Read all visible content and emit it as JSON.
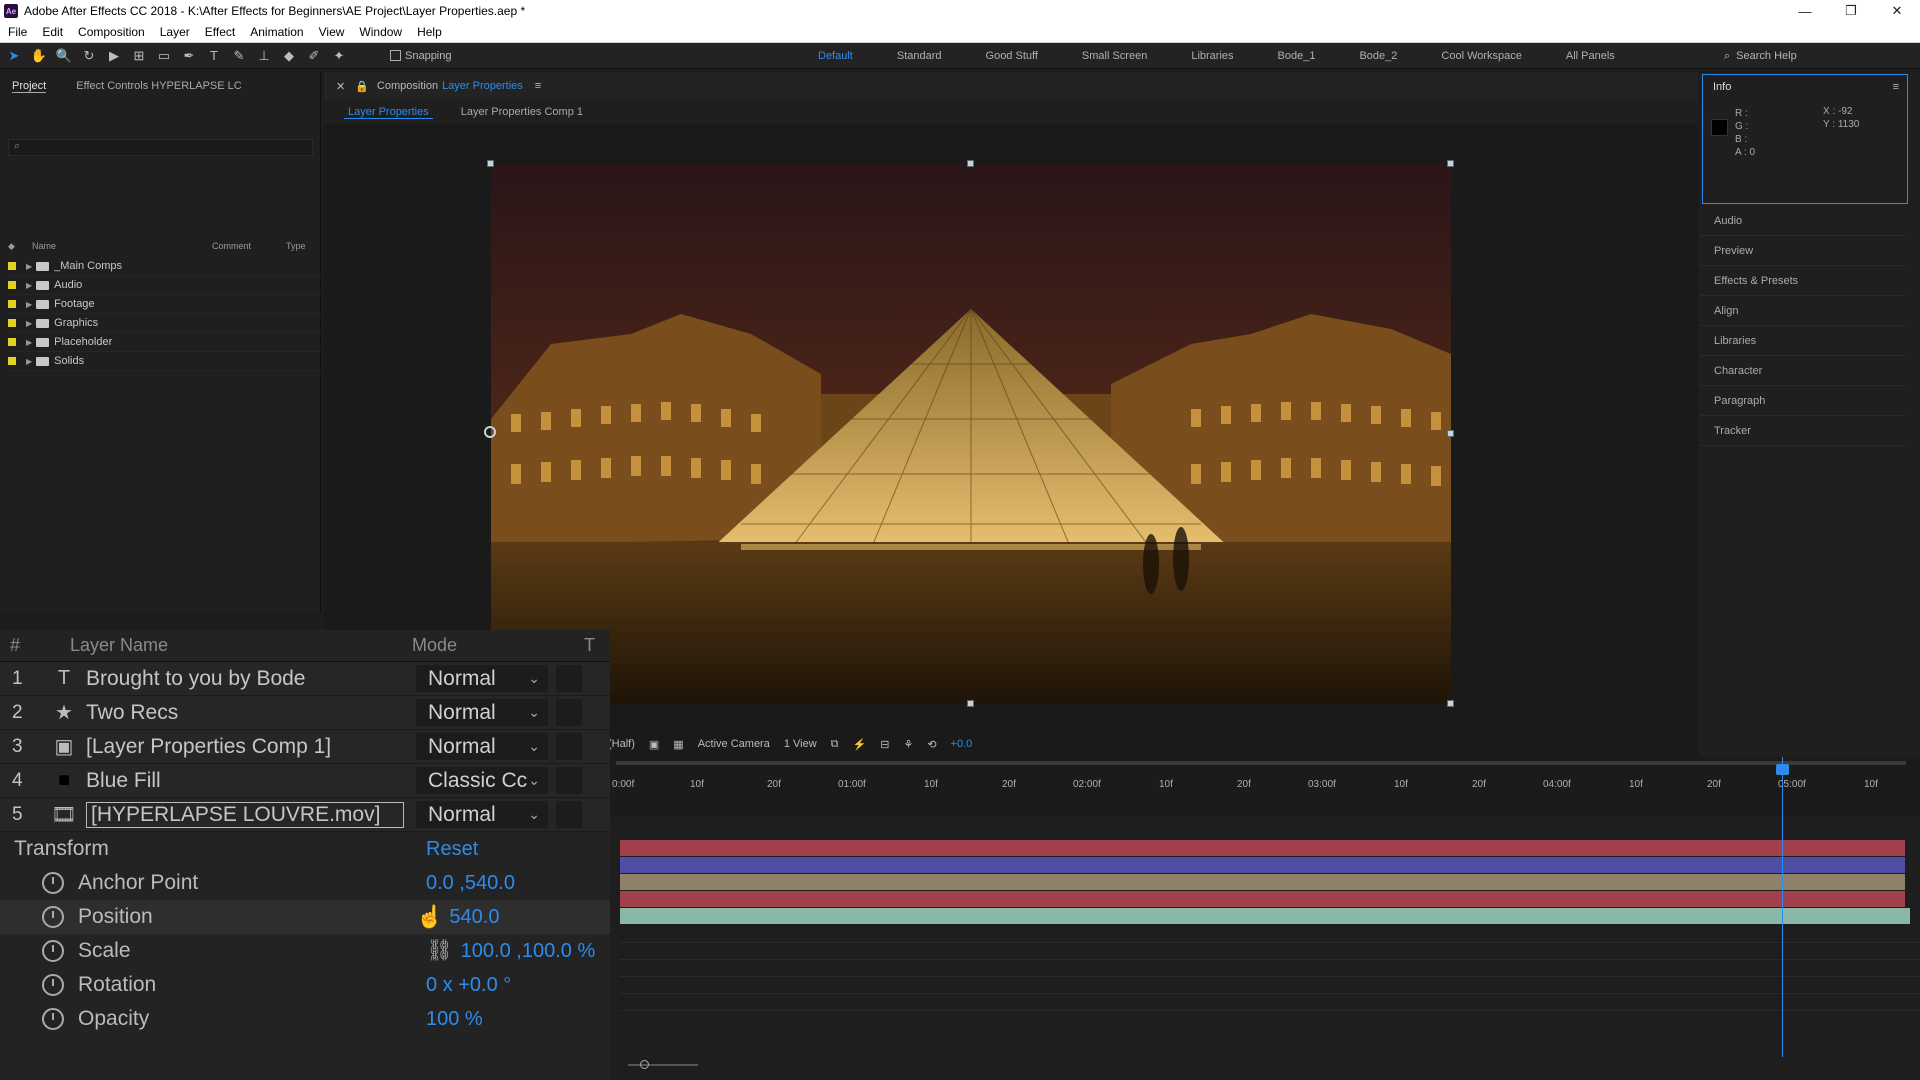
{
  "window": {
    "title": "Adobe After Effects CC 2018 - K:\\After Effects for Beginners\\AE Project\\Layer Properties.aep *",
    "logo": "Ae",
    "controls": [
      "—",
      "❐",
      "✕"
    ]
  },
  "menu": [
    "File",
    "Edit",
    "Composition",
    "Layer",
    "Effect",
    "Animation",
    "View",
    "Window",
    "Help"
  ],
  "toolbar": {
    "snapping_label": "Snapping",
    "workspaces": [
      "Default",
      "Standard",
      "Good Stuff",
      "Small Screen",
      "Libraries",
      "Bode_1",
      "Bode_2",
      "Cool Workspace",
      "All Panels"
    ],
    "active_workspace": "Default",
    "search_placeholder": "Search Help"
  },
  "project_panel": {
    "tab_project": "Project",
    "tab_effect_controls": "Effect Controls HYPERLAPSE LC",
    "search_placeholder": "⌕",
    "columns": [
      "Name",
      "Comment",
      "Type"
    ],
    "items": [
      "_Main Comps",
      "Audio",
      "Footage",
      "Graphics",
      "Placeholder",
      "Solids"
    ]
  },
  "composition": {
    "tab_prefix": "Composition",
    "tab_name": "Layer Properties",
    "crumb_active": "Layer Properties",
    "crumb_next": "Layer Properties Comp 1",
    "resolution": "(Half)",
    "camera": "Active Camera",
    "views": "1 View",
    "exposure": "+0.0"
  },
  "info_panel": {
    "title": "Info",
    "r": "R :",
    "g": "G :",
    "b": "B :",
    "a": "A :  0",
    "x": "X : -92",
    "y": "Y : 1130",
    "panels": [
      "Audio",
      "Preview",
      "Effects & Presets",
      "Align",
      "Libraries",
      "Character",
      "Paragraph",
      "Tracker"
    ]
  },
  "layers": {
    "col_num": "#",
    "col_name": "Layer Name",
    "col_mode": "Mode",
    "col_t": "T",
    "rows": [
      {
        "num": "1",
        "icon": "T",
        "name": "Brought to you by Bode",
        "mode": "Normal"
      },
      {
        "num": "2",
        "icon": "★",
        "name": "Two Recs",
        "mode": "Normal"
      },
      {
        "num": "3",
        "icon": "▣",
        "name": "[Layer Properties Comp 1]",
        "mode": "Normal"
      },
      {
        "num": "4",
        "icon": "■",
        "name": "Blue Fill",
        "mode": "Classic Cc"
      },
      {
        "num": "5",
        "icon": "🎞",
        "name": "[HYPERLAPSE LOUVRE.mov]",
        "mode": "Normal"
      }
    ],
    "transform_label": "Transform",
    "reset_label": "Reset",
    "properties": [
      {
        "name": "Anchor Point",
        "value": "0.0 ,540.0"
      },
      {
        "name": "Position",
        "value": "540.0"
      },
      {
        "name": "Scale",
        "value": "100.0 ,100.0 %"
      },
      {
        "name": "Rotation",
        "value": "0 x +0.0 °"
      },
      {
        "name": "Opacity",
        "value": "100 %"
      }
    ]
  },
  "timeline": {
    "ticks": [
      "0:00f",
      "10f",
      "20f",
      "01:00f",
      "10f",
      "20f",
      "02:00f",
      "10f",
      "20f",
      "03:00f",
      "10f",
      "20f",
      "04:00f",
      "10f",
      "20f",
      "05:00f",
      "10f"
    ],
    "bar_colors": [
      "#a3404e",
      "#4e4fa4",
      "#8f8167",
      "#a3404e",
      "#8ab8a8"
    ]
  }
}
